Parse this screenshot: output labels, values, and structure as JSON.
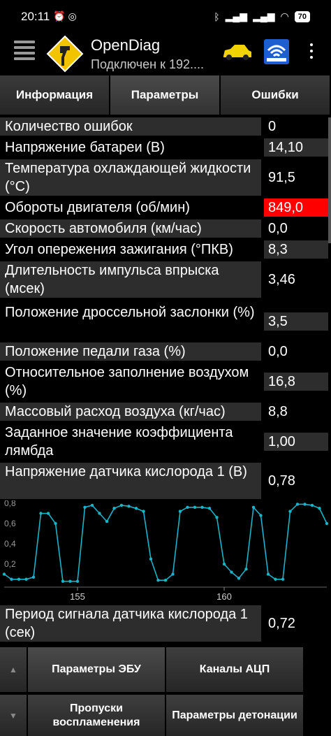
{
  "status_bar": {
    "time": "20:11",
    "left_icons": [
      "alarm-icon",
      "whatsapp-icon"
    ],
    "right_icons": [
      "bluetooth-icon",
      "signal-icon",
      "signal-icon",
      "wifi-icon"
    ],
    "battery": "70"
  },
  "app": {
    "title": "OpenDiag",
    "subtitle": "Подключен к 192....",
    "icons": [
      "menu-icon",
      "app-logo-icon",
      "car-icon",
      "wifi-adapter-icon",
      "more-icon"
    ]
  },
  "tabs": [
    {
      "label": "Информация",
      "active": false
    },
    {
      "label": "Параметры",
      "active": true
    },
    {
      "label": "Ошибки",
      "active": false
    }
  ],
  "params": [
    {
      "label": "Количество ошибок",
      "value": "0"
    },
    {
      "label": "Напряжение батареи (В)",
      "value": "14,10"
    },
    {
      "label": "Температура охлаждающей жидкости (°С)",
      "value": "91,5"
    },
    {
      "label": "Обороты двигателя (об/мин)",
      "value": "849,0",
      "alert": true
    },
    {
      "label": "Скорость автомобиля (км/час)",
      "value": "0,0"
    },
    {
      "label": "Угол опережения зажигания (°ПКВ)",
      "value": "8,3"
    },
    {
      "label": "Длительность импульса впрыска (мсек)",
      "value": "3,46"
    },
    {
      "label": "Положение дроссельной заслонки (%)",
      "value": "3,5"
    },
    {
      "label": "Положение педали газа (%)",
      "value": "0,0"
    },
    {
      "label": "Относительное заполнение воздухом (%)",
      "value": "16,8"
    },
    {
      "label": "Массовый расход воздуха (кг/час)",
      "value": "8,8"
    },
    {
      "label": "Заданное значение коэффициента лямбда",
      "value": "1,00"
    },
    {
      "label": "Напряжение датчика кислорода 1 (В)",
      "value": "0,78"
    }
  ],
  "chart_data": {
    "type": "line",
    "x_ticks": [
      "155",
      "160"
    ],
    "y_ticks": [
      "0,2",
      "0,4",
      "0,6",
      "0,8"
    ],
    "ylim": [
      0,
      0.8
    ],
    "xlim": [
      152.5,
      163.5
    ],
    "line_color": "#1bb3c8",
    "x": [
      152.5,
      152.75,
      153.0,
      153.25,
      153.5,
      153.75,
      154.0,
      154.25,
      154.5,
      154.75,
      155.0,
      155.25,
      155.5,
      155.75,
      156.0,
      156.25,
      156.5,
      156.75,
      157.0,
      157.25,
      157.5,
      157.75,
      158.0,
      158.25,
      158.5,
      158.75,
      159.0,
      159.25,
      159.5,
      159.75,
      160.0,
      160.25,
      160.5,
      160.75,
      161.0,
      161.25,
      161.5,
      161.75,
      162.0,
      162.25,
      162.5,
      162.75,
      163.0,
      163.25,
      163.5
    ],
    "values": [
      0.1,
      0.05,
      0.05,
      0.05,
      0.07,
      0.7,
      0.7,
      0.6,
      0.03,
      0.03,
      0.03,
      0.76,
      0.78,
      0.7,
      0.62,
      0.75,
      0.78,
      0.77,
      0.75,
      0.72,
      0.25,
      0.04,
      0.04,
      0.1,
      0.72,
      0.76,
      0.76,
      0.76,
      0.75,
      0.66,
      0.2,
      0.12,
      0.06,
      0.15,
      0.76,
      0.68,
      0.1,
      0.05,
      0.05,
      0.72,
      0.79,
      0.79,
      0.78,
      0.75,
      0.6
    ]
  },
  "params_after_chart": [
    {
      "label": "Период сигнала датчика кислорода 1 (сек)",
      "value": "0,72"
    }
  ],
  "bottom_nav": {
    "up_arrow": "▲",
    "down_arrow": "▼",
    "buttons": [
      {
        "label": "Параметры ЭБУ",
        "active": true
      },
      {
        "label": "Каналы АЦП",
        "active": false
      },
      {
        "label": "Пропуски воспламенения",
        "active": false
      },
      {
        "label": "Параметры детонации",
        "active": false
      }
    ]
  }
}
